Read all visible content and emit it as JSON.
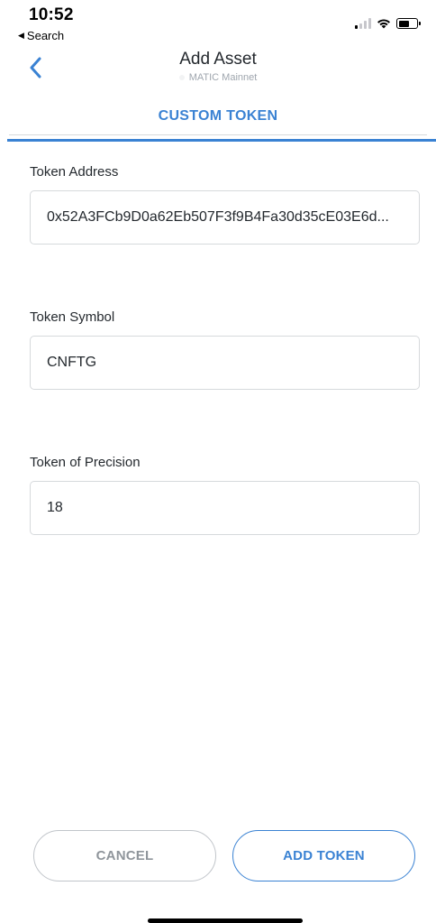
{
  "status_bar": {
    "time": "10:52",
    "back_app_label": "Search",
    "back_app_arrow": "◀",
    "signal_bars_on": 1,
    "signal_bars_total": 4,
    "battery_level": 0.6
  },
  "nav": {
    "title": "Add Asset",
    "subtitle": "MATIC Mainnet",
    "back_icon": "chevron-left-icon"
  },
  "tab": {
    "label": "CUSTOM TOKEN"
  },
  "fields": {
    "address": {
      "label": "Token Address",
      "value": "0x52A3FCb9D0a62Eb507F3f9B4Fa30d35cE03E6d..."
    },
    "symbol": {
      "label": "Token Symbol",
      "value": "CNFTG"
    },
    "precision": {
      "label": "Token of Precision",
      "value": "18"
    }
  },
  "buttons": {
    "cancel": "CANCEL",
    "add": "ADD TOKEN"
  },
  "colors": {
    "accent": "#3a82d3",
    "text": "#24292e",
    "muted": "#9fa6ae",
    "border": "#d6d9dc"
  }
}
